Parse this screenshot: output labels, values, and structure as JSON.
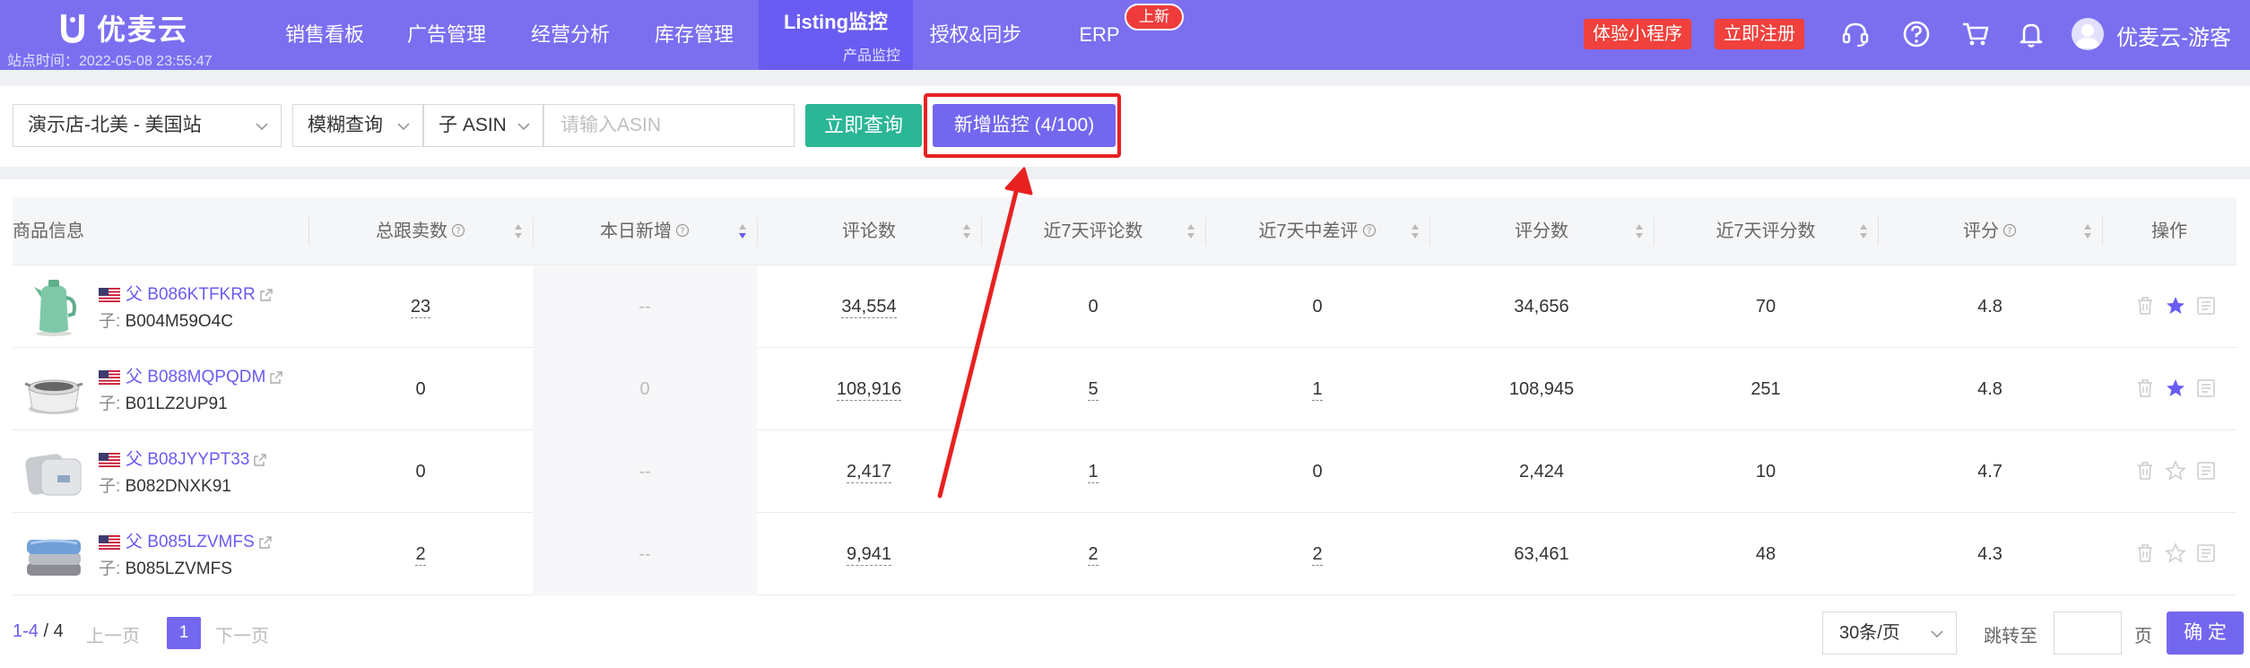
{
  "header": {
    "logo_text": "优麦云",
    "site_time": "站点时间：2022-05-08 23:55:47",
    "nav": [
      {
        "label": "销售看板"
      },
      {
        "label": "广告管理"
      },
      {
        "label": "经营分析"
      },
      {
        "label": "库存管理"
      },
      {
        "label": "Listing监控",
        "sub": "产品监控"
      },
      {
        "label": "授权&同步"
      },
      {
        "label": "ERP",
        "badge": "上新"
      }
    ],
    "mini_program_btn": "体验小程序",
    "register_btn": "立即注册",
    "username": "优麦云-游客"
  },
  "search": {
    "store": "演示店-北美 - 美国站",
    "match_mode": "模糊查询",
    "asin_type": "子 ASIN",
    "asin_placeholder": "请输入ASIN",
    "query_btn": "立即查询",
    "add_btn": "新增监控 (4/100)"
  },
  "table": {
    "columns": [
      "商品信息",
      "总跟卖数",
      "本日新增",
      "评论数",
      "近7天评论数",
      "近7天中差评",
      "评分数",
      "近7天评分数",
      "评分",
      "操作"
    ],
    "rows": [
      {
        "parent_prefix": "父",
        "parent": "B086KTFKRR",
        "child_prefix": "子:",
        "child": "B004M59O4C",
        "sellers": "23",
        "today_new": "--",
        "reviews": "34,554",
        "reviews_7d": "0",
        "neg_7d": "0",
        "ratings": "34,656",
        "ratings_7d": "70",
        "score": "4.8",
        "starred": true
      },
      {
        "parent_prefix": "父",
        "parent": "B088MQPQDM",
        "child_prefix": "子:",
        "child": "B01LZ2UP91",
        "sellers": "0",
        "today_new": "0",
        "reviews": "108,916",
        "reviews_7d": "5",
        "neg_7d": "1",
        "ratings": "108,945",
        "ratings_7d": "251",
        "score": "4.8",
        "starred": true
      },
      {
        "parent_prefix": "父",
        "parent": "B08JYYPT33",
        "child_prefix": "子:",
        "child": "B082DNXK91",
        "sellers": "0",
        "today_new": "--",
        "reviews": "2,417",
        "reviews_7d": "1",
        "neg_7d": "0",
        "ratings": "2,424",
        "ratings_7d": "10",
        "score": "4.7",
        "starred": false
      },
      {
        "parent_prefix": "父",
        "parent": "B085LZVMFS",
        "child_prefix": "子:",
        "child": "B085LZVMFS",
        "sellers": "2",
        "today_new": "--",
        "reviews": "9,941",
        "reviews_7d": "2",
        "neg_7d": "2",
        "ratings": "63,461",
        "ratings_7d": "48",
        "score": "4.3",
        "starred": false
      }
    ]
  },
  "pagination": {
    "range": "1-4",
    "sep": " / ",
    "total": "4",
    "prev": "上一页",
    "current": "1",
    "next": "下一页",
    "page_size": "30条/页",
    "jump_to": "跳转至",
    "page_unit": "页",
    "confirm": "确 定"
  },
  "colors": {
    "brand": "#7b6ff0",
    "primary_btn": "#7467ef",
    "query_btn": "#2bb696",
    "red": "#f0413c",
    "annotation": "#e82121"
  }
}
